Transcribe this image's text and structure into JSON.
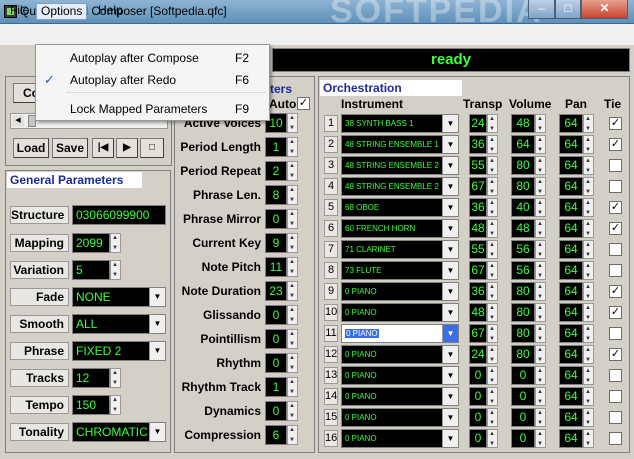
{
  "window": {
    "title": "QuasiFractal Composer [Softpedia.qfc]",
    "watermark": "SOFTPEDIA"
  },
  "menu": {
    "file": "File",
    "options": "Options",
    "help": "Help"
  },
  "options_menu": [
    {
      "label": "Autoplay after Compose",
      "shortcut": "F2",
      "checked": false
    },
    {
      "label": "Autoplay after Redo",
      "shortcut": "F6",
      "checked": true
    },
    {
      "label": "Lock Mapped Parameters",
      "shortcut": "F9",
      "checked": false
    }
  ],
  "status": "ready",
  "transport": {
    "compose_tab": "Co",
    "load": "Load",
    "save": "Save"
  },
  "general": {
    "title": "General Parameters",
    "structure": {
      "label": "Structure",
      "value": "03066099900"
    },
    "mapping": {
      "label": "Mapping",
      "value": "2099"
    },
    "variation": {
      "label": "Variation",
      "value": "5"
    },
    "fade": {
      "label": "Fade",
      "value": "NONE"
    },
    "smooth": {
      "label": "Smooth",
      "value": "ALL"
    },
    "phrase": {
      "label": "Phrase",
      "value": "FIXED 2"
    },
    "tracks": {
      "label": "Tracks",
      "value": "12"
    },
    "tempo": {
      "label": "Tempo",
      "value": "150"
    },
    "tonality": {
      "label": "Tonality",
      "value": "CHROMATIC"
    }
  },
  "mapped": {
    "title_partial": "ters",
    "auto_label": "Auto",
    "rows": [
      {
        "label": "Active Voices",
        "value": "10"
      },
      {
        "label": "Period Length",
        "value": "1"
      },
      {
        "label": "Period Repeat",
        "value": "2"
      },
      {
        "label": "Phrase Len.",
        "value": "8"
      },
      {
        "label": "Phrase Mirror",
        "value": "0"
      },
      {
        "label": "Current Key",
        "value": "9"
      },
      {
        "label": "Note Pitch",
        "value": "11"
      },
      {
        "label": "Note Duration",
        "value": "23"
      },
      {
        "label": "Glissando",
        "value": "0"
      },
      {
        "label": "Pointillism",
        "value": "0"
      },
      {
        "label": "Rhythm",
        "value": "0"
      },
      {
        "label": "Rhythm Track",
        "value": "1"
      },
      {
        "label": "Dynamics",
        "value": "0"
      },
      {
        "label": "Compression",
        "value": "6"
      }
    ]
  },
  "orchestration": {
    "title": "Orchestration",
    "headers": {
      "instrument": "Instrument",
      "transp": "Transp",
      "volume": "Volume",
      "pan": "Pan",
      "tie": "Tie"
    },
    "rows": [
      {
        "n": "1",
        "instrument": "38 SYNTH BASS 1",
        "transp": "24",
        "volume": "48",
        "pan": "64",
        "tie": true
      },
      {
        "n": "2",
        "instrument": "48 STRING ENSEMBLE 1",
        "transp": "36",
        "volume": "64",
        "pan": "64",
        "tie": true
      },
      {
        "n": "3",
        "instrument": "48 STRING ENSEMBLE 2",
        "transp": "55",
        "volume": "80",
        "pan": "64",
        "tie": false
      },
      {
        "n": "4",
        "instrument": "48 STRING ENSEMBLE 2",
        "transp": "67",
        "volume": "80",
        "pan": "64",
        "tie": false
      },
      {
        "n": "5",
        "instrument": "68 OBOE",
        "transp": "36",
        "volume": "40",
        "pan": "64",
        "tie": true
      },
      {
        "n": "6",
        "instrument": "60 FRENCH HORN",
        "transp": "48",
        "volume": "48",
        "pan": "64",
        "tie": true
      },
      {
        "n": "7",
        "instrument": "71 CLARINET",
        "transp": "55",
        "volume": "56",
        "pan": "64",
        "tie": false
      },
      {
        "n": "8",
        "instrument": "73 FLUTE",
        "transp": "67",
        "volume": "56",
        "pan": "64",
        "tie": false
      },
      {
        "n": "9",
        "instrument": "0 PIANO",
        "transp": "36",
        "volume": "80",
        "pan": "64",
        "tie": true
      },
      {
        "n": "10",
        "instrument": "0 PIANO",
        "transp": "48",
        "volume": "80",
        "pan": "64",
        "tie": true
      },
      {
        "n": "11",
        "instrument": "0 PIANO",
        "transp": "67",
        "volume": "80",
        "pan": "64",
        "tie": false,
        "selected": true
      },
      {
        "n": "12",
        "instrument": "0 PIANO",
        "transp": "24",
        "volume": "80",
        "pan": "64",
        "tie": true
      },
      {
        "n": "13",
        "instrument": "0 PIANO",
        "transp": "0",
        "volume": "0",
        "pan": "64",
        "tie": false
      },
      {
        "n": "14",
        "instrument": "0 PIANO",
        "transp": "0",
        "volume": "0",
        "pan": "64",
        "tie": false
      },
      {
        "n": "15",
        "instrument": "0 PIANO",
        "transp": "0",
        "volume": "0",
        "pan": "64",
        "tie": false
      },
      {
        "n": "16",
        "instrument": "0 PIANO",
        "transp": "0",
        "volume": "0",
        "pan": "64",
        "tie": false
      }
    ]
  }
}
